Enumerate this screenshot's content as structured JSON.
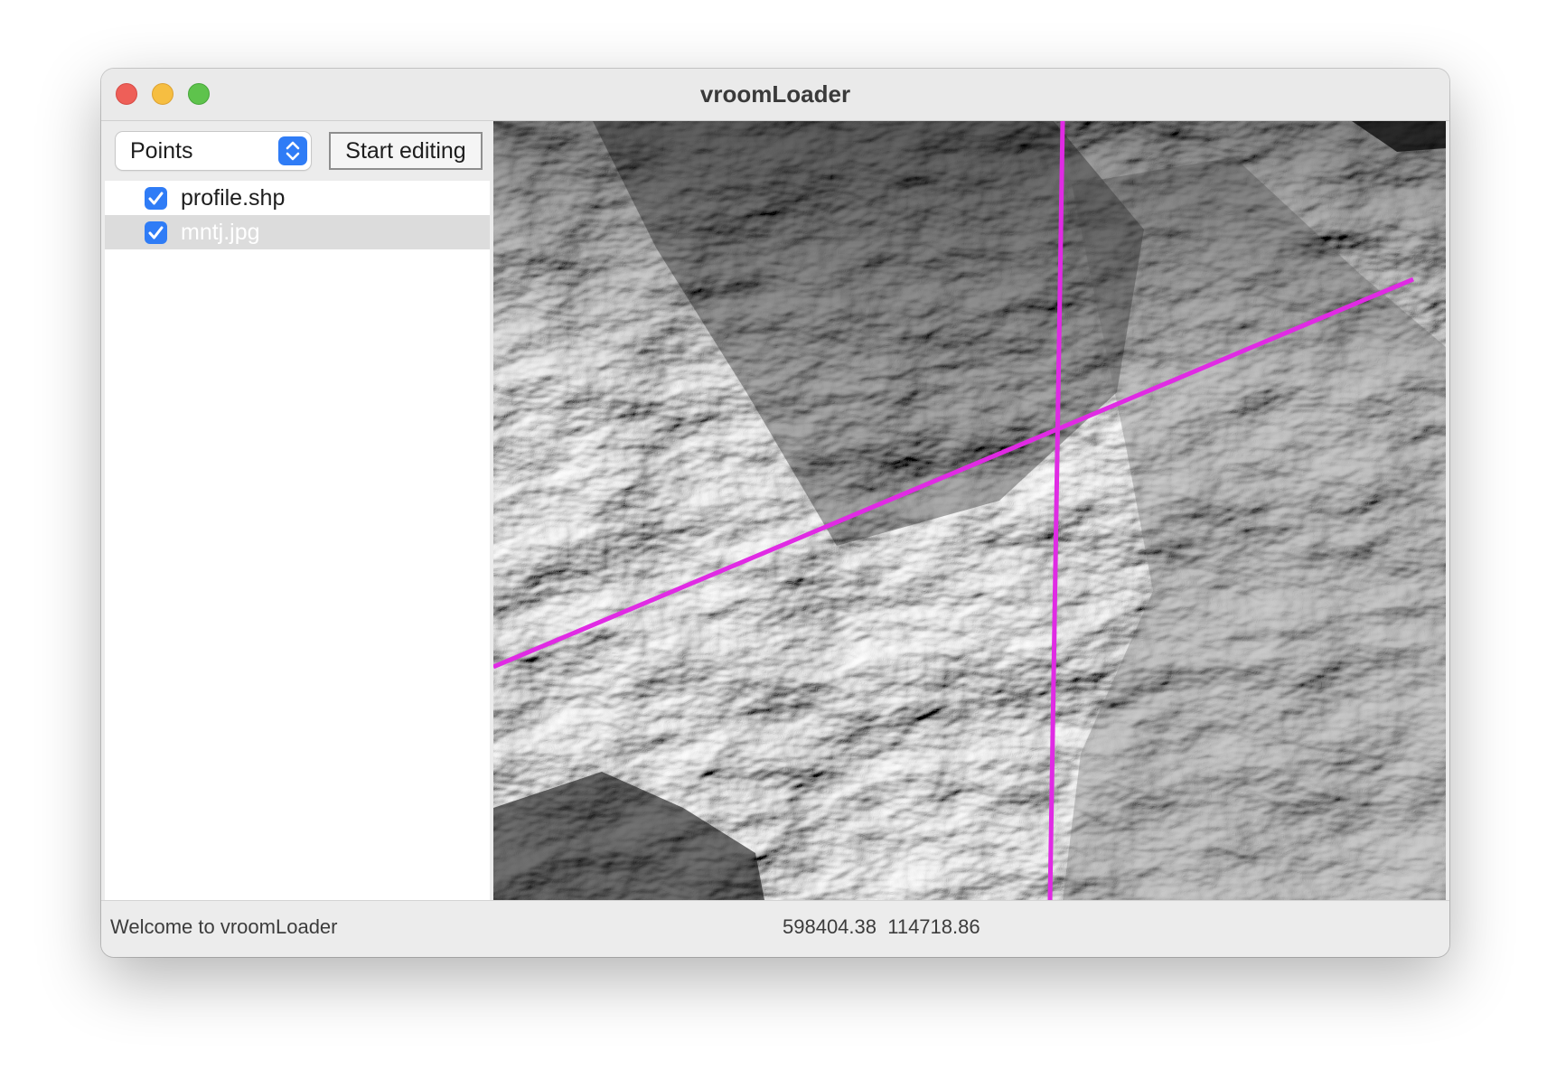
{
  "window": {
    "title": "vroomLoader"
  },
  "toolbar": {
    "mode_select": {
      "selected": "Points"
    },
    "edit_button_label": "Start editing"
  },
  "layers": [
    {
      "name": "profile.shp",
      "visible": true,
      "selected": false
    },
    {
      "name": "mntj.jpg",
      "visible": true,
      "selected": true
    }
  ],
  "map": {
    "raster_description": "grayscale hillshade of mountainous terrain",
    "line_color": "#e02ae4"
  },
  "statusbar": {
    "message": "Welcome to vroomLoader",
    "coord_x": "598404.38",
    "coord_y": "114718.86"
  },
  "colors": {
    "accent": "#2f7cf6",
    "selection_bg": "#dcdcdc",
    "close": "#ee5f58",
    "minimize": "#f6be41",
    "zoom": "#5ec34c"
  }
}
